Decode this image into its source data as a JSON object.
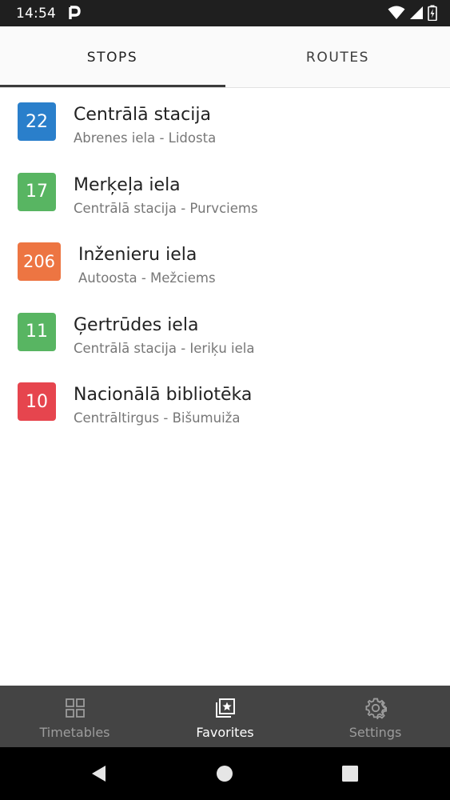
{
  "status_bar": {
    "time": "14:54",
    "icons": [
      "p-app-icon",
      "wifi-icon",
      "signal-icon",
      "battery-icon"
    ]
  },
  "tabs": [
    {
      "label": "STOPS",
      "active": true
    },
    {
      "label": "ROUTES",
      "active": false
    }
  ],
  "favorites": [
    {
      "route": "22",
      "color": "#2a7fcb",
      "title": "Centrālā stacija",
      "subtitle": "Abrenes iela - Lidosta"
    },
    {
      "route": "17",
      "color": "#58b562",
      "title": "Merķeļa iela",
      "subtitle": "Centrālā stacija - Purvciems"
    },
    {
      "route": "206",
      "color": "#ed7542",
      "title": "Inženieru iela",
      "subtitle": "Autoosta - Mežciems"
    },
    {
      "route": "11",
      "color": "#58b562",
      "title": "Ģertrūdes iela",
      "subtitle": "Centrālā stacija - Ieriķu iela"
    },
    {
      "route": "10",
      "color": "#e6454e",
      "title": "Nacionālā bibliotēka",
      "subtitle": "Centrāltirgus - Bišumuiža"
    }
  ],
  "bottom_nav": [
    {
      "label": "Timetables",
      "icon": "grid-icon",
      "active": false
    },
    {
      "label": "Favorites",
      "icon": "star-collection-icon",
      "active": true
    },
    {
      "label": "Settings",
      "icon": "gear-icon",
      "active": false
    }
  ],
  "system_nav": [
    "back-icon",
    "home-icon",
    "recents-icon"
  ]
}
